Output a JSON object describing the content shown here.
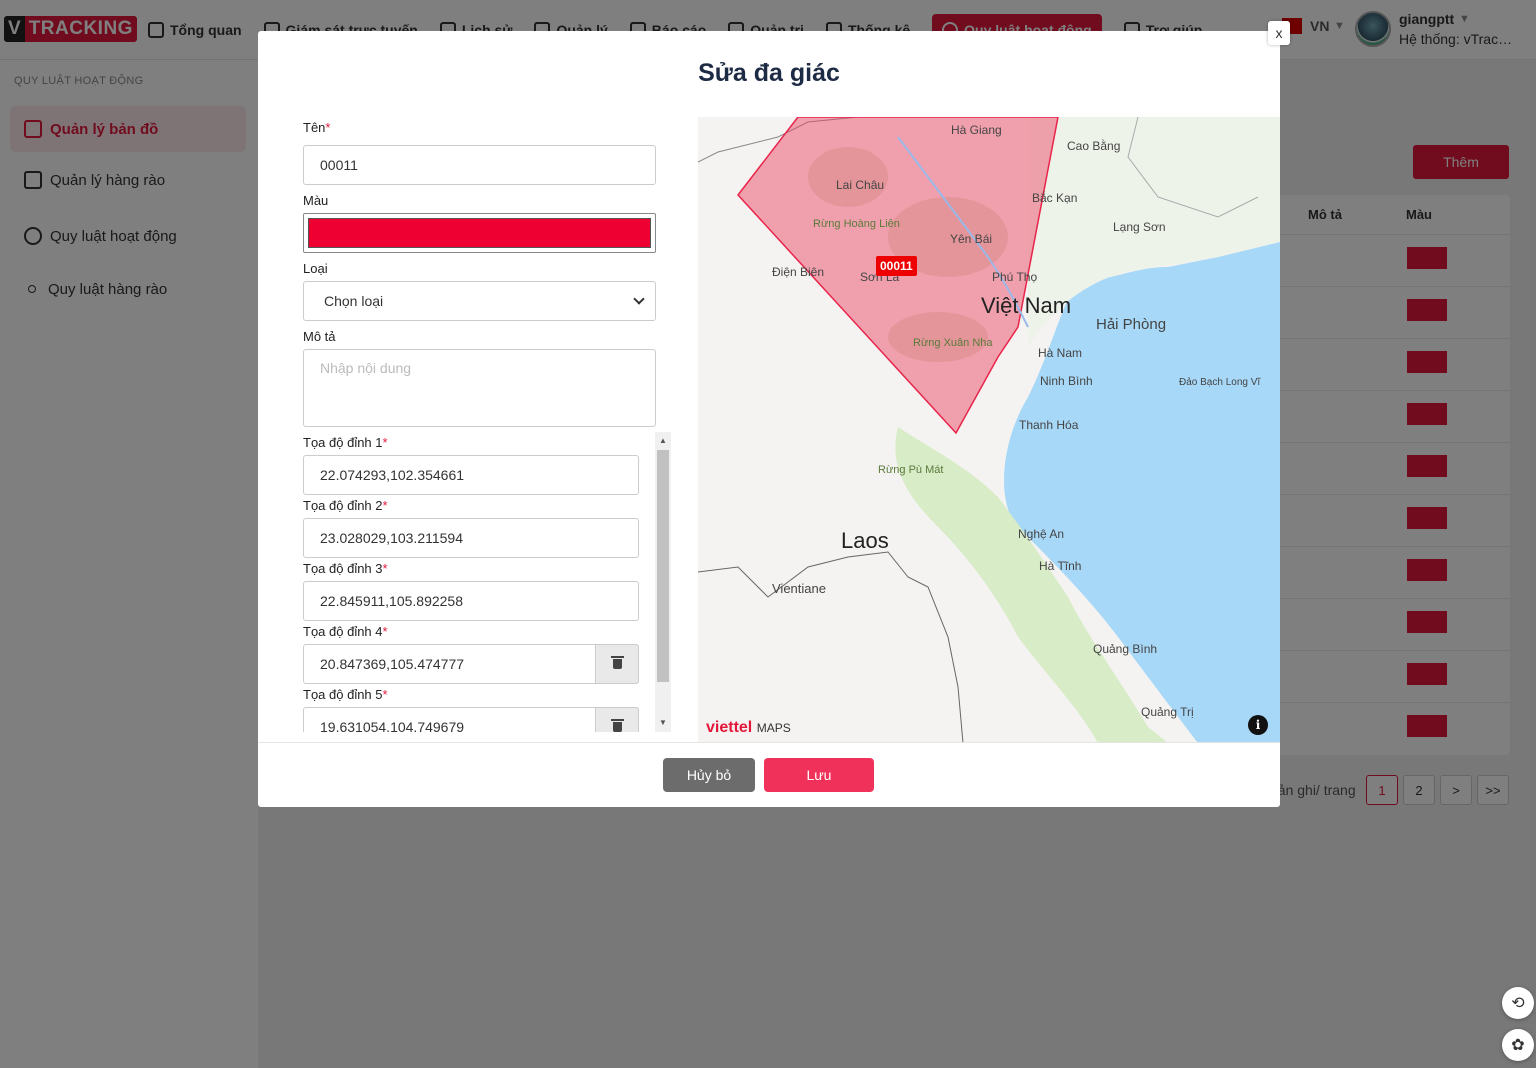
{
  "app": {
    "logo_v": "V",
    "logo_text": "TRACKING"
  },
  "nav": [
    {
      "label": "Tổng quan"
    },
    {
      "label": "Giám sát trực tuyến"
    },
    {
      "label": "Lịch sử"
    },
    {
      "label": "Quản lý"
    },
    {
      "label": "Báo cáo"
    },
    {
      "label": "Quản trị"
    },
    {
      "label": "Thống kê"
    },
    {
      "label": "Quy luật hoạt động"
    },
    {
      "label": "Trợ giúp"
    }
  ],
  "user": {
    "lang": "VN",
    "name": "giangptt",
    "system": "Hệ thống: vTracking"
  },
  "sidebar": {
    "title": "QUY LUẬT HOẠT ĐỘNG",
    "items": [
      {
        "label": "Quản lý bản đồ"
      },
      {
        "label": "Quản lý hàng rào"
      },
      {
        "label": "Quy luật hoạt động"
      },
      {
        "label": "Quy luật hàng rào"
      }
    ]
  },
  "page": {
    "add_label": "Thêm",
    "col_desc": "Mô tả",
    "col_color": "Màu",
    "pager_label": "bản ghi/ trang",
    "pages": [
      "1",
      "2",
      ">",
      ">>"
    ],
    "row_color": "#c8102e"
  },
  "modal": {
    "title": "Sửa đa giác",
    "close": "x",
    "name_label": "Tên",
    "name_value": "00011",
    "color_label": "Màu",
    "color_value": "#ef0033",
    "type_label": "Loại",
    "type_value": "Chọn loại",
    "desc_label": "Mô tả",
    "desc_placeholder": "Nhập nội dung",
    "coords": [
      {
        "label": "Tọa độ đỉnh 1",
        "value": "22.074293,102.354661"
      },
      {
        "label": "Tọa độ đỉnh 2",
        "value": "23.028029,103.211594"
      },
      {
        "label": "Tọa độ đỉnh 3",
        "value": "22.845911,105.892258"
      },
      {
        "label": "Tọa độ đỉnh 4",
        "value": "20.847369,105.474777"
      },
      {
        "label": "Tọa độ đỉnh 5",
        "value": "19.631054,104.749679"
      }
    ],
    "cancel_label": "Hủy bỏ",
    "save_label": "Lưu"
  },
  "map": {
    "polygon_tag": "00011",
    "brand": "viettel",
    "brand_suffix": "MAPS",
    "labels": [
      "Hà Giang",
      "Cao Bằng",
      "Lai Châu",
      "Bắc Kạn",
      "Lạng Sơn",
      "Rừng Hoàng Liên",
      "Yên Bái",
      "Điện Biên",
      "Sơn La",
      "Phú Thọ",
      "Việt Nam",
      "Hải Phòng",
      "Rừng Xuân Nha",
      "Hà Nam",
      "Ninh Bình",
      "Đảo Bạch Long Vĩ",
      "Thanh Hóa",
      "Rừng Pù Mát",
      "Laos",
      "Nghệ An",
      "Hà Tĩnh",
      "Vientiane",
      "Quảng Bình",
      "Quảng Trị"
    ]
  }
}
